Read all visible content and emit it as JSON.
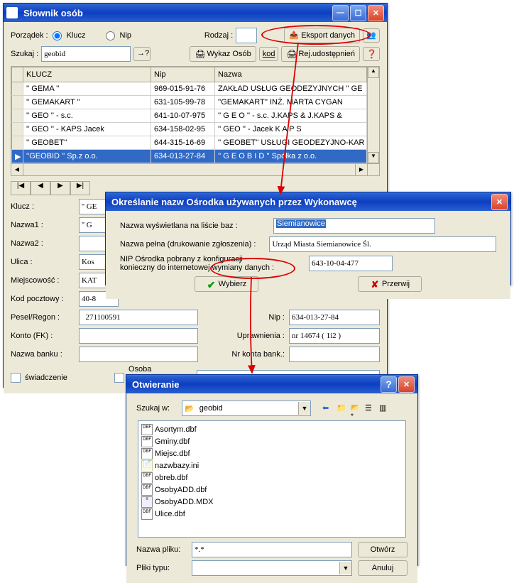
{
  "w1": {
    "title": "Słownik osób",
    "porzadek_label": "Porządek :",
    "radio_klucz": "Klucz",
    "radio_nip": "Nip",
    "rodzaj_label": "Rodzaj :",
    "rodzaj_value": "",
    "eksport_btn": "Eksport danych",
    "szukaj_label": "Szukaj :",
    "szukaj_value": "geobid",
    "wykaz_btn": "Wykaz Osób",
    "kod_btn": "kod",
    "rej_btn": "Rej.udostępnień",
    "cols": [
      "KLUCZ",
      "Nip",
      "Nazwa"
    ],
    "rows": [
      {
        "k": "'' GEMA ''",
        "n": "969-015-91-76",
        "z": "ZAKŁAD USŁUG GEODEZYJNYCH '' GE"
      },
      {
        "k": "'' GEMAKART ''",
        "n": "631-105-99-78",
        "z": "''GEMAKART'' INŻ. MARTA CYGAN"
      },
      {
        "k": "'' GEO '' - s.c.",
        "n": "641-10-07-975",
        "z": "    '' G E O '' - s.c.   J.KAPS & J.KAPS &"
      },
      {
        "k": "'' GEO '' - KAPS Jacek",
        "n": "634-158-02-95",
        "z": "'' GEO '' - Jacek  K  A  P  S"
      },
      {
        "k": "'' GEOBET''",
        "n": "644-315-16-69",
        "z": "'' GEOBET'' USŁUGI GEODEZYJNO-KAR"
      },
      {
        "k": "''GEOBID ''   Sp.z o.o.",
        "n": "634-013-27-84",
        "z": "'' G E O B I D ''  Spółka z o.o.",
        "sel": true
      }
    ],
    "fields": {
      "klucz_l": "Klucz :",
      "klucz_v": "'' GE",
      "nazwa1_l": "Nazwa1 :",
      "nazwa1_v": "'' G",
      "nazwa2_l": "Nazwa2 :",
      "nazwa2_v": "",
      "ulica_l": "Ulica :",
      "ulica_v": "Kos",
      "miejsc_l": "Miejscowość :",
      "miejsc_v": "KAT",
      "kod_l": "Kod pocztowy :",
      "kod_v": "40-8",
      "pesel_l": "Pesel/Regon :",
      "pesel_v": "  271100591",
      "nip_l": "Nip :",
      "nip_v": "634-013-27-84",
      "konto_l": "Konto (FK) :",
      "konto_v": "",
      "upr_l": "Uprawnienia :",
      "upr_v": "nr 14674 ( 1i2 )",
      "bank_l": "Nazwa banku :",
      "bank_v": "",
      "nrk_l": "Nr konta bank.:",
      "nrk_v": "",
      "swiad_l": "świadczenie",
      "osoba_l": "Osoba upoważniona do odbioru faktury:",
      "osoba_v": ""
    }
  },
  "w2": {
    "title": "Określanie nazw Ośrodka używanych przez Wykonawcę",
    "l1": "Nazwa wyświetlana na liście baz :",
    "v1": "Siemianowice",
    "l2": "Nazwa pełna (drukowanie zgłoszenia) :",
    "v2": "Urząd Miasta Siemianowice Śl.",
    "l3a": "NIP Ośrodka pobrany z konfiguracji",
    "l3b": "konieczny do internetowej wymiany danych :",
    "v3": "643-10-04-477",
    "btn_ok": "Wybierz",
    "btn_cancel": "Przerwij"
  },
  "w3": {
    "title": "Otwieranie",
    "szukaj_l": "Szukaj w:",
    "folder": "geobid",
    "files_col1": [
      "Asortym.dbf",
      "Gminy.dbf",
      "Miejsc.dbf",
      "nazwbazy.ini",
      "obreb.dbf",
      "OsobyADD.dbf"
    ],
    "files_col2": [
      "OsobyADD.MDX",
      "Ulice.dbf"
    ],
    "nazwa_l": "Nazwa pliku:",
    "nazwa_v": "*.*",
    "typ_l": "Pliki typu:",
    "typ_v": "",
    "open": "Otwórz",
    "cancel": "Anuluj"
  }
}
